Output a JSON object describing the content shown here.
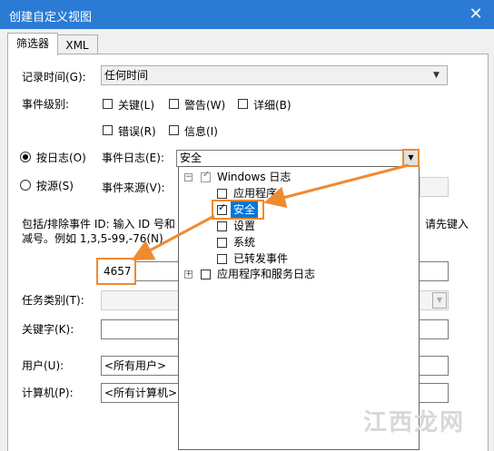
{
  "window": {
    "title": "创建自定义视图",
    "close_glyph": "✕"
  },
  "tabs": [
    "筛选器",
    "XML"
  ],
  "form": {
    "logged_label": "记录时间(G):",
    "logged_value": "任何时间",
    "level_label": "事件级别:",
    "levels": [
      "关键(L)",
      "警告(W)",
      "详细(B)",
      "错误(R)",
      "信息(I)"
    ],
    "by_log_label": "按日志(O)",
    "by_source_label": "按源(S)",
    "event_logs_label": "事件日志(E):",
    "event_logs_value": "安全",
    "event_sources_label": "事件来源(V):",
    "ids_desc_line1": "包括/排除事件 ID: 输入 ID 号和",
    "ids_desc_line1_right": "请先键入",
    "ids_desc_line2": "减号。例如 1,3,5-99,-76(N)",
    "event_id_value": "4657",
    "task_category_label": "任务类别(T):",
    "keywords_label": "关键字(K):",
    "user_label": "用户(U):",
    "user_value": "<所有用户>",
    "computer_label": "计算机(P):",
    "computer_value": "<所有计算机>"
  },
  "tree": {
    "root_label": "Windows 日志",
    "items": [
      "应用程序",
      "安全",
      "设置",
      "系统",
      "已转发事件"
    ],
    "second_root_label": "应用程序和服务日志"
  },
  "watermark": "江西龙网",
  "colors": {
    "titlebar": "#2b7bd4",
    "highlight": "#f08a30",
    "selection": "#0078d7"
  }
}
